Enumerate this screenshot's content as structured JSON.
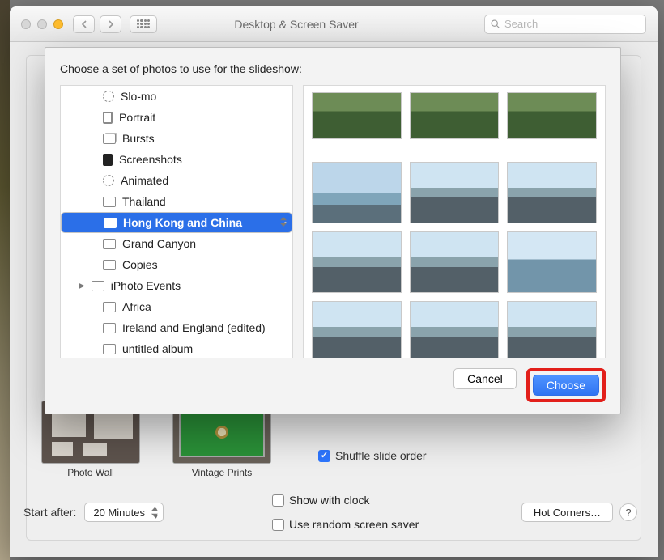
{
  "window": {
    "title": "Desktop & Screen Saver",
    "search_placeholder": "Search"
  },
  "sheet": {
    "instruction": "Choose a set of photos to use for the slideshow:",
    "cancel_label": "Cancel",
    "choose_label": "Choose",
    "selected_index": 6,
    "items": [
      {
        "label": "Slo-mo",
        "icon": "slomo",
        "depth": 3
      },
      {
        "label": "Portrait",
        "icon": "portrait",
        "depth": 3
      },
      {
        "label": "Bursts",
        "icon": "bursts",
        "depth": 3
      },
      {
        "label": "Screenshots",
        "icon": "screens",
        "depth": 3
      },
      {
        "label": "Animated",
        "icon": "animated",
        "depth": 3
      },
      {
        "label": "Thailand",
        "icon": "folder",
        "depth": 3
      },
      {
        "label": "Hong Kong and China",
        "icon": "folder",
        "depth": 3
      },
      {
        "label": "Grand Canyon",
        "icon": "folder",
        "depth": 3
      },
      {
        "label": "Copies",
        "icon": "folder",
        "depth": 3
      },
      {
        "label": "iPhoto Events",
        "icon": "folder",
        "depth": 2,
        "disclosure": true
      },
      {
        "label": "Africa",
        "icon": "folder",
        "depth": 3
      },
      {
        "label": "Ireland and England (edited)",
        "icon": "folder",
        "depth": 3
      },
      {
        "label": "untitled album",
        "icon": "folder",
        "depth": 3
      }
    ],
    "thumbnails": [
      "green",
      "green",
      "green",
      "sky",
      "city",
      "city",
      "city",
      "city",
      "sea",
      "city",
      "city",
      "city"
    ]
  },
  "options": {
    "shuffle_label": "Shuffle slide order",
    "shuffle_checked": true,
    "show_clock_label": "Show with clock",
    "show_clock_checked": false,
    "random_label": "Use random screen saver",
    "random_checked": false
  },
  "screensavers": [
    {
      "name": "Photo Wall",
      "style": "pw"
    },
    {
      "name": "Vintage Prints",
      "style": "vp"
    }
  ],
  "start_after": {
    "label": "Start after:",
    "value": "20 Minutes"
  },
  "hot_corners_label": "Hot Corners…",
  "help_label": "?"
}
